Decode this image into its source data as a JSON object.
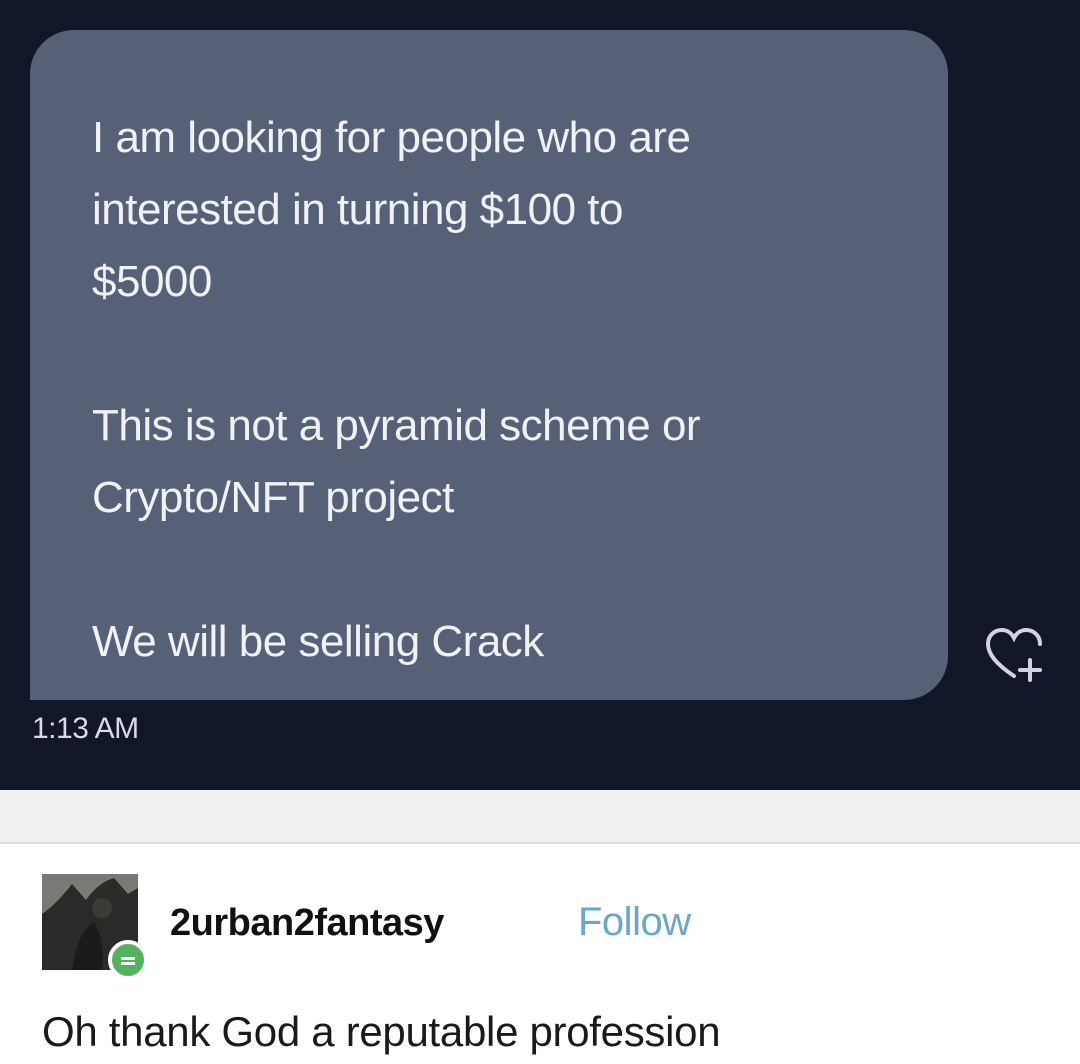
{
  "message": {
    "paragraphs": [
      "I am looking for people who are\ninterested in turning $100 to\n$5000",
      "This is not a pyramid scheme or\nCrypto/NFT project",
      "We will be selling Crack"
    ],
    "timestamp": "1:13 AM",
    "react_icon": "heart-plus-icon"
  },
  "post": {
    "username": "2urban2fantasy",
    "follow_label": "Follow",
    "comment": "Oh thank God a reputable profession",
    "avatar_badge_icon": "online-badge-icon"
  },
  "colors": {
    "dm_background": "#111628",
    "bubble": "#566177",
    "follow_link": "#6aa7c9"
  }
}
